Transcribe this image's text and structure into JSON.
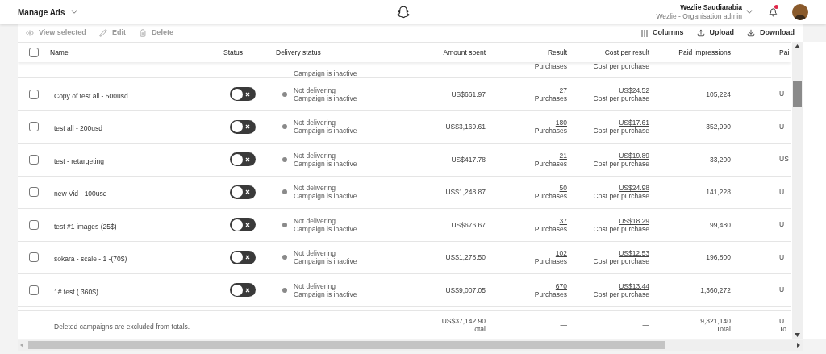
{
  "header": {
    "title": "Manage Ads",
    "user_name": "Wezlie Saudiarabia",
    "user_role": "Wezlie - Organisation admin",
    "notification_unread": true
  },
  "toolbar": {
    "left": [
      {
        "kind": "view",
        "label": "View selected",
        "disabled": true
      },
      {
        "kind": "edit",
        "label": "Edit",
        "disabled": true
      },
      {
        "kind": "delete",
        "label": "Delete",
        "disabled": true
      }
    ],
    "right": [
      {
        "kind": "columns",
        "label": "Columns",
        "disabled": false
      },
      {
        "kind": "upload",
        "label": "Upload",
        "disabled": false
      },
      {
        "kind": "download",
        "label": "Download",
        "disabled": false
      }
    ]
  },
  "table": {
    "select_all_checked": false,
    "columns": [
      "Name",
      "Status",
      "Delivery status",
      "Amount spent",
      "Result",
      "Cost per result",
      "Paid impressions",
      "Pai"
    ],
    "partial_row": {
      "delivery_detail": "Campaign is inactive",
      "result_label": "Purchases",
      "cost_label": "Cost per purchase"
    },
    "rows": [
      {
        "checked": false,
        "name": "Copy of test all - 500usd",
        "on": false,
        "delivery": "Not delivering",
        "delivery_detail": "Campaign is inactive",
        "amount_spent": "US$661.97",
        "result": "27",
        "result_label": "Purchases",
        "cost_per_result": "US$24.52",
        "cost_label": "Cost per purchase",
        "paid_impressions": "105,224",
        "column_9": "U"
      },
      {
        "checked": false,
        "name": "test all - 200usd",
        "on": false,
        "delivery": "Not delivering",
        "delivery_detail": "Campaign is inactive",
        "amount_spent": "US$3,169.61",
        "result": "180",
        "result_label": "Purchases",
        "cost_per_result": "US$17.61",
        "cost_label": "Cost per purchase",
        "paid_impressions": "352,990",
        "column_9": "U"
      },
      {
        "checked": false,
        "name": "test - retargeting",
        "on": false,
        "delivery": "Not delivering",
        "delivery_detail": "Campaign is inactive",
        "amount_spent": "US$417.78",
        "result": "21",
        "result_label": "Purchases",
        "cost_per_result": "US$19.89",
        "cost_label": "Cost per purchase",
        "paid_impressions": "33,200",
        "column_9": "US"
      },
      {
        "checked": false,
        "name": "new Vid - 100usd",
        "on": false,
        "delivery": "Not delivering",
        "delivery_detail": "Campaign is inactive",
        "amount_spent": "US$1,248.87",
        "result": "50",
        "result_label": "Purchases",
        "cost_per_result": "US$24.98",
        "cost_label": "Cost per purchase",
        "paid_impressions": "141,228",
        "column_9": "U"
      },
      {
        "checked": false,
        "name": "test #1 images (25$)",
        "on": false,
        "delivery": "Not delivering",
        "delivery_detail": "Campaign is inactive",
        "amount_spent": "US$676.67",
        "result": "37",
        "result_label": "Purchases",
        "cost_per_result": "US$18.29",
        "cost_label": "Cost per purchase",
        "paid_impressions": "99,480",
        "column_9": "U"
      },
      {
        "checked": false,
        "name": "sokara - scale - 1 -(70$)",
        "on": false,
        "delivery": "Not delivering",
        "delivery_detail": "Campaign is inactive",
        "amount_spent": "US$1,278.50",
        "result": "102",
        "result_label": "Purchases",
        "cost_per_result": "US$12.53",
        "cost_label": "Cost per purchase",
        "paid_impressions": "196,800",
        "column_9": "U"
      },
      {
        "checked": false,
        "name": "1# test ( 360$)",
        "on": false,
        "delivery": "Not delivering",
        "delivery_detail": "Campaign is inactive",
        "amount_spent": "US$9,007.05",
        "result": "670",
        "result_label": "Purchases",
        "cost_per_result": "US$13.44",
        "cost_label": "Cost per purchase",
        "paid_impressions": "1,360,272",
        "column_9": "U"
      }
    ],
    "totals": {
      "note": "Deleted campaigns are excluded from totals.",
      "amount_spent": "US$37,142.90",
      "amount_label": "Total",
      "result": "—",
      "cost_per_result": "—",
      "paid_impressions": "9,321,140",
      "impressions_label": "Total",
      "column_9": "U",
      "column_9_label": "To"
    }
  }
}
